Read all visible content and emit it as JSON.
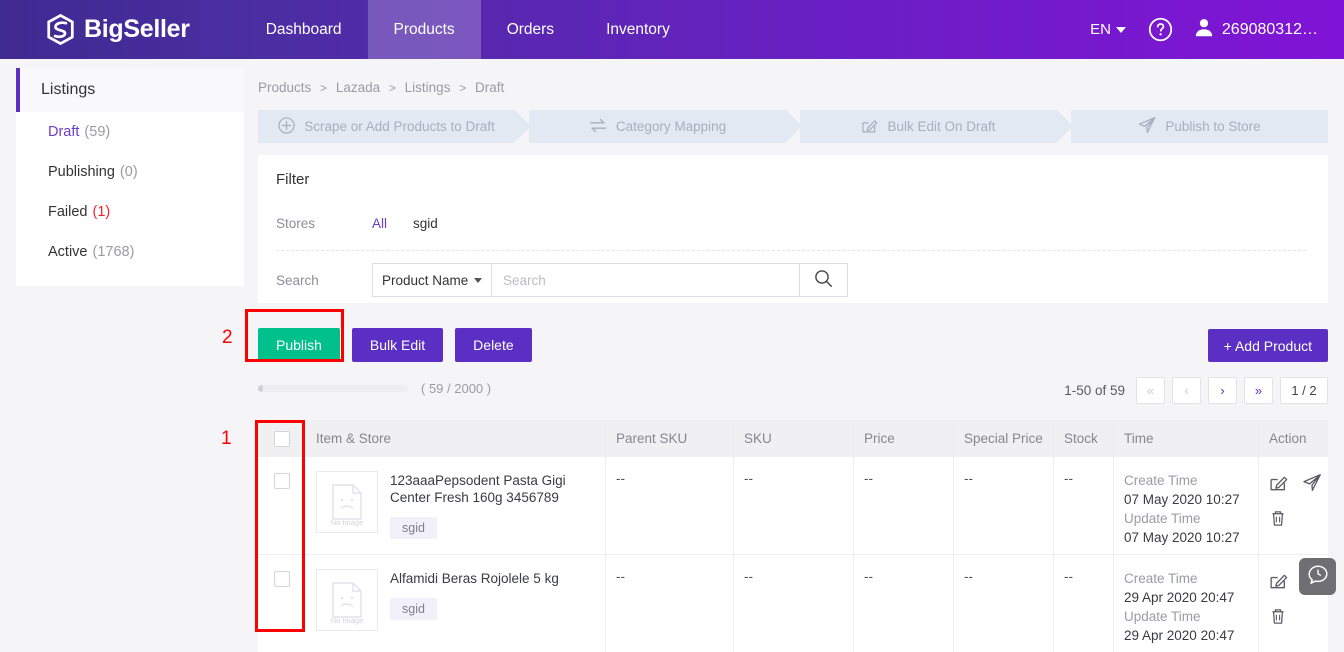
{
  "header": {
    "brand": "BigSeller",
    "logo_icon": "bigseller-hex-logo",
    "nav": [
      {
        "label": "Dashboard",
        "active": false
      },
      {
        "label": "Products",
        "active": true
      },
      {
        "label": "Orders",
        "active": false
      },
      {
        "label": "Inventory",
        "active": false
      }
    ],
    "language": "EN",
    "help_icon": "question-circle-icon",
    "user_icon": "user-icon",
    "username": "269080312…",
    "colors": {
      "nav_start": "#3f2a91",
      "nav_end": "#8014d6"
    }
  },
  "sidebar": {
    "title": "Listings",
    "items": [
      {
        "label": "Draft",
        "count": "(59)",
        "active": true,
        "danger": false
      },
      {
        "label": "Publishing",
        "count": "(0)",
        "active": false,
        "danger": false
      },
      {
        "label": "Failed",
        "count": "(1)",
        "active": false,
        "danger": true
      },
      {
        "label": "Active",
        "count": "(1768)",
        "active": false,
        "danger": false
      }
    ]
  },
  "breadcrumb": [
    "Products",
    "Lazada",
    "Listings",
    "Draft"
  ],
  "stepper": [
    {
      "label": "Scrape or Add Products to Draft",
      "icon": "plus-circle-icon"
    },
    {
      "label": "Category Mapping",
      "icon": "swap-arrows-icon"
    },
    {
      "label": "Bulk Edit On Draft",
      "icon": "edit-square-icon"
    },
    {
      "label": "Publish to Store",
      "icon": "paper-plane-icon"
    }
  ],
  "filter": {
    "title": "Filter",
    "stores_label": "Stores",
    "stores_options": [
      {
        "label": "All",
        "selected": true
      },
      {
        "label": "sgid",
        "selected": false
      }
    ],
    "search_label": "Search",
    "search_field": "Product Name",
    "search_value": "",
    "search_placeholder": "Search",
    "search_icon": "magnifier-icon"
  },
  "toolbar": {
    "publish_label": "Publish",
    "bulk_edit_label": "Bulk Edit",
    "delete_label": "Delete",
    "add_product_label": "+ Add Product",
    "publish_color": "#00c08b",
    "purple_color": "#5b2fc4"
  },
  "progress": {
    "text": "( 59 / 2000 )",
    "current": 59,
    "max": 2000
  },
  "pagination": {
    "range_text": "1-50 of 59",
    "first_label": "«",
    "prev_label": "‹",
    "next_label": "›",
    "last_label": "»",
    "page_label": "1 / 2"
  },
  "table": {
    "columns": [
      "Item & Store",
      "Parent SKU",
      "SKU",
      "Price",
      "Special Price",
      "Stock",
      "Time",
      "Action"
    ],
    "time_labels": {
      "create": "Create Time",
      "update": "Update Time"
    },
    "no_image_text": "No Image",
    "action_icons": [
      "edit-square-icon",
      "paper-plane-icon",
      "trash-icon"
    ],
    "rows": [
      {
        "name": "123aaaPepsodent Pasta Gigi Center Fresh 160g 3456789",
        "store": "sgid",
        "parent_sku": "--",
        "sku": "--",
        "price": "--",
        "special_price": "--",
        "stock": "--",
        "create_time": "07 May 2020 10:27",
        "update_time": "07 May 2020 10:27"
      },
      {
        "name": "Alfamidi Beras Rojolele 5 kg",
        "store": "sgid",
        "parent_sku": "--",
        "sku": "--",
        "price": "--",
        "special_price": "--",
        "stock": "--",
        "create_time": "29 Apr 2020 20:47",
        "update_time": "29 Apr 2020 20:47"
      }
    ]
  },
  "annotations": [
    {
      "number": "1",
      "target": "select-all-checkbox-column"
    },
    {
      "number": "2",
      "target": "publish-button"
    }
  ],
  "chat": {
    "icon": "chat-bubble-icon"
  }
}
